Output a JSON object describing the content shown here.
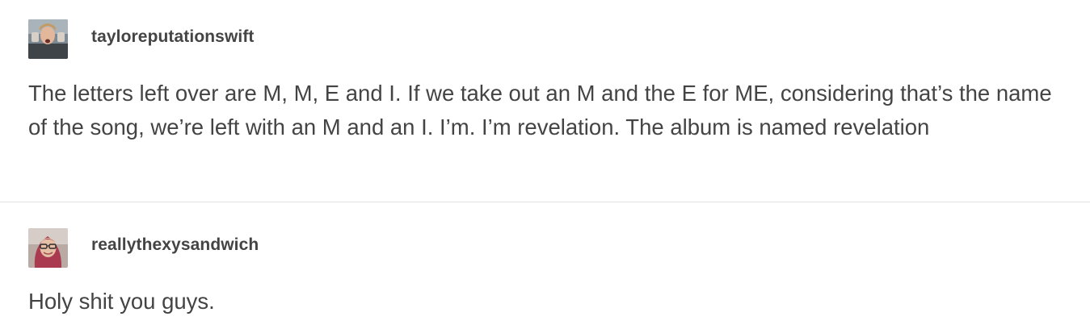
{
  "posts": [
    {
      "username": "tayloreputationswift",
      "avatar_icon": "user-avatar-photo",
      "text": "The letters left over are M, M, E and I. If we take out an M and the E for ME, considering that’s the name of the song, we’re left with an M and an I. I’m. I’m revelation. The album is named revelation"
    },
    {
      "username": "reallythexysandwich",
      "avatar_icon": "user-avatar-photo",
      "text": "Holy shit you guys."
    }
  ],
  "colors": {
    "text": "#444444",
    "divider": "#e3e3e3",
    "background": "#ffffff"
  }
}
